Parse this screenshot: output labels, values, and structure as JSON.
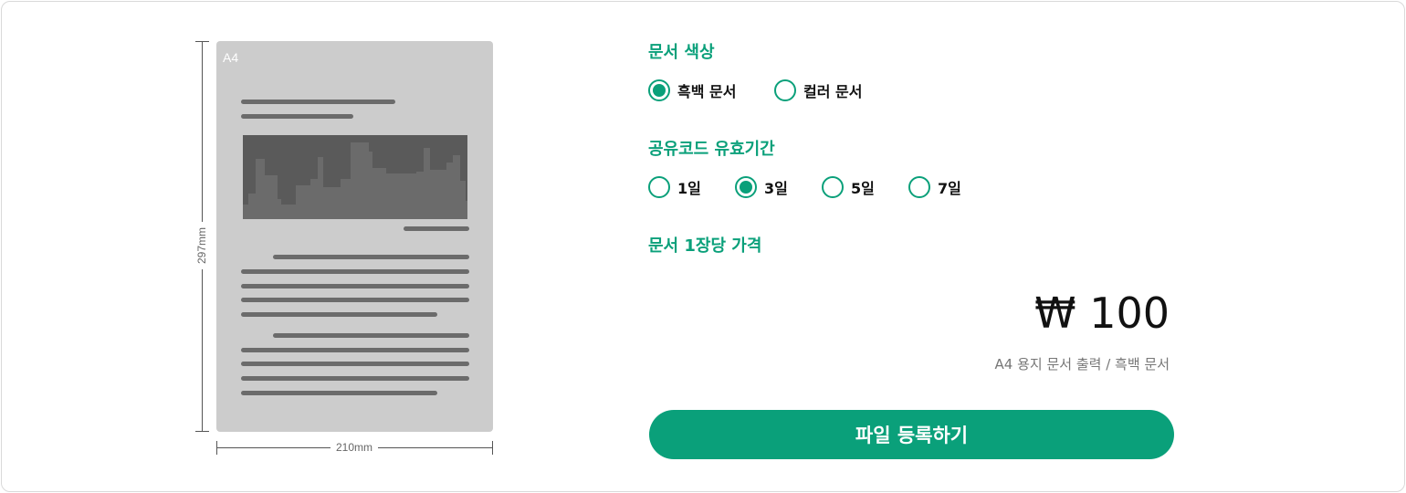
{
  "preview": {
    "paper_size": "A4",
    "height_label": "297mm",
    "width_label": "210mm"
  },
  "color_section": {
    "title": "문서 색상",
    "options": [
      {
        "label": "흑백 문서",
        "selected": true
      },
      {
        "label": "컬러 문서",
        "selected": false
      }
    ]
  },
  "validity_section": {
    "title": "공유코드 유효기간",
    "options": [
      {
        "label": "1일",
        "selected": false
      },
      {
        "label": "3일",
        "selected": true
      },
      {
        "label": "5일",
        "selected": false
      },
      {
        "label": "7일",
        "selected": false
      }
    ]
  },
  "price_section": {
    "title": "문서 1장당 가격",
    "price": "₩ 100",
    "note": "A4 용지 문서 출력 / 흑백 문서"
  },
  "submit_button": {
    "label": "파일 등록하기"
  },
  "colors": {
    "accent": "#0aa07a",
    "paper": "#cccccc",
    "paper_ink": "#6b6b6b"
  }
}
